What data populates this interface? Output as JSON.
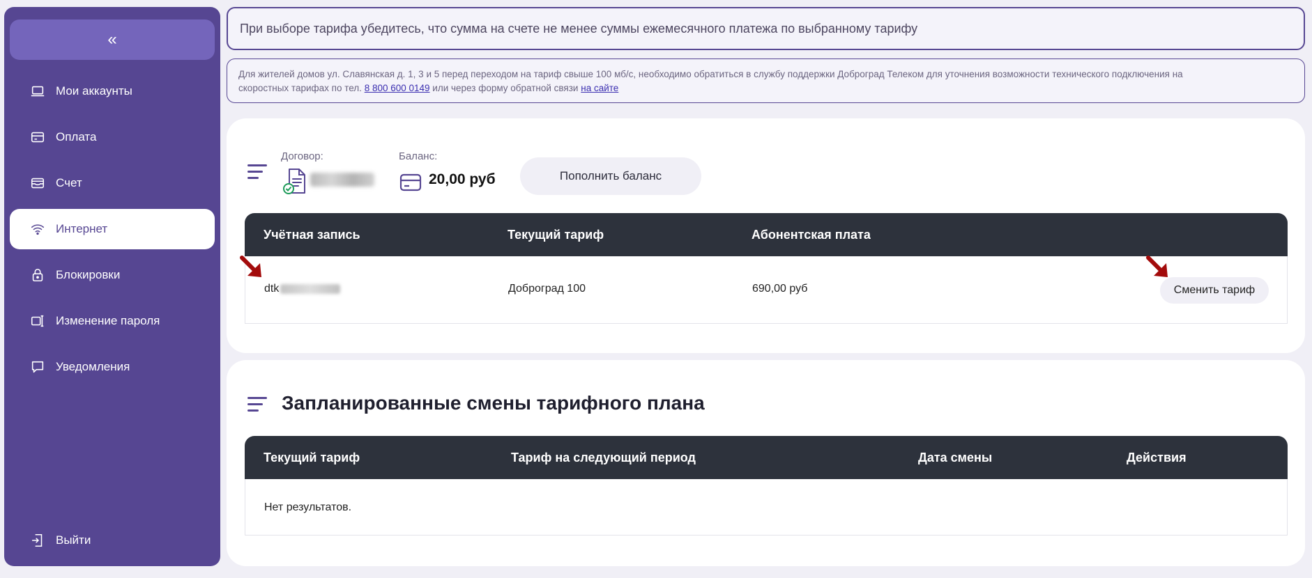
{
  "sidebar": {
    "collapse_label": "«",
    "items": [
      {
        "label": "Мои аккаунты",
        "icon": "laptop-icon",
        "active": false
      },
      {
        "label": "Оплата",
        "icon": "card-icon",
        "active": false
      },
      {
        "label": "Счет",
        "icon": "bill-icon",
        "active": false
      },
      {
        "label": "Интернет",
        "icon": "wifi-icon",
        "active": true
      },
      {
        "label": "Блокировки",
        "icon": "lock-icon",
        "active": false
      },
      {
        "label": "Изменение пароля",
        "icon": "password-icon",
        "active": false
      },
      {
        "label": "Уведомления",
        "icon": "chat-icon",
        "active": false
      }
    ],
    "logout_label": "Выйти"
  },
  "notices": {
    "main": "При выборе тарифа убедитесь, что сумма на счете не менее суммы ежемесячного платежа по выбранному тарифу",
    "sub_line1": "Для жителей домов ул. Славянская д. 1, 3 и 5 перед переходом на тариф свыше 100 мб/с, необходимо обратиться в службу поддержки Доброград Телеком для уточнения возможности технического подключения на",
    "sub_line2_prefix": "скоростных тарифах по тел.",
    "sub_phone": "8 800 600 0149",
    "sub_mid": "или через форму обратной связи",
    "sub_link": "на сайте"
  },
  "account": {
    "contract_label": "Договор:",
    "balance_label": "Баланс:",
    "balance_value": "20,00 руб",
    "topup_label": "Пополнить баланс"
  },
  "tariff_table": {
    "headers": [
      "Учётная запись",
      "Текущий тариф",
      "Абонентская плата"
    ],
    "row": {
      "account_prefix": "dtk",
      "tariff": "Доброград 100",
      "fee": "690,00 руб",
      "action_label": "Сменить тариф"
    }
  },
  "scheduled": {
    "title": "Запланированные смены тарифного плана",
    "headers": [
      "Текущий тариф",
      "Тариф на следующий период",
      "Дата смены",
      "Действия"
    ],
    "empty_text": "Нет результатов."
  },
  "colors": {
    "sidebar": "#564692",
    "accent": "#7465bb",
    "table_header": "#2d323c",
    "arrow": "#a30b0b"
  }
}
